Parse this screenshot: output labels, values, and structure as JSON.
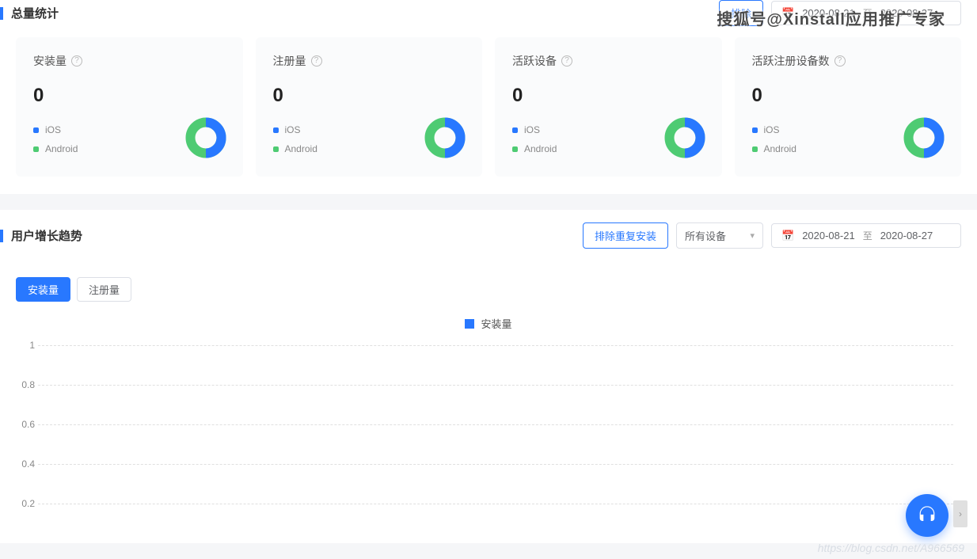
{
  "watermark": "搜狐号@Xinstall应用推广专家",
  "stats": {
    "title": "总量统计",
    "exclude_btn": "排除",
    "date_range": {
      "start": "2020-08-21",
      "end": "2020-08-27",
      "sep": "至"
    },
    "cards": [
      {
        "title": "安装量",
        "value": "0",
        "legend": [
          {
            "label": "iOS",
            "color": "ios"
          },
          {
            "label": "Android",
            "color": "android"
          }
        ]
      },
      {
        "title": "注册量",
        "value": "0",
        "legend": [
          {
            "label": "iOS",
            "color": "ios"
          },
          {
            "label": "Android",
            "color": "android"
          }
        ]
      },
      {
        "title": "活跃设备",
        "value": "0",
        "legend": [
          {
            "label": "iOS",
            "color": "ios"
          },
          {
            "label": "Android",
            "color": "android"
          }
        ]
      },
      {
        "title": "活跃注册设备数",
        "value": "0",
        "legend": [
          {
            "label": "iOS",
            "color": "ios"
          },
          {
            "label": "Android",
            "color": "android"
          }
        ]
      }
    ]
  },
  "trend": {
    "title": "用户增长趋势",
    "exclude_btn": "排除重复安装",
    "device_select": "所有设备",
    "date_range": {
      "start": "2020-08-21",
      "end": "2020-08-27",
      "sep": "至"
    },
    "tabs": [
      {
        "label": "安装量",
        "active": true
      },
      {
        "label": "注册量",
        "active": false
      }
    ],
    "chart_legend_label": "安装量"
  },
  "chart_data": {
    "type": "line",
    "series": [
      {
        "name": "安装量",
        "values": []
      }
    ],
    "categories": [],
    "y_ticks": [
      1,
      0.8,
      0.6,
      0.4,
      0.2
    ],
    "ylim": [
      0,
      1
    ],
    "xlabel": "",
    "ylabel": ""
  },
  "footer_url": "https://blog.csdn.net/A966569"
}
